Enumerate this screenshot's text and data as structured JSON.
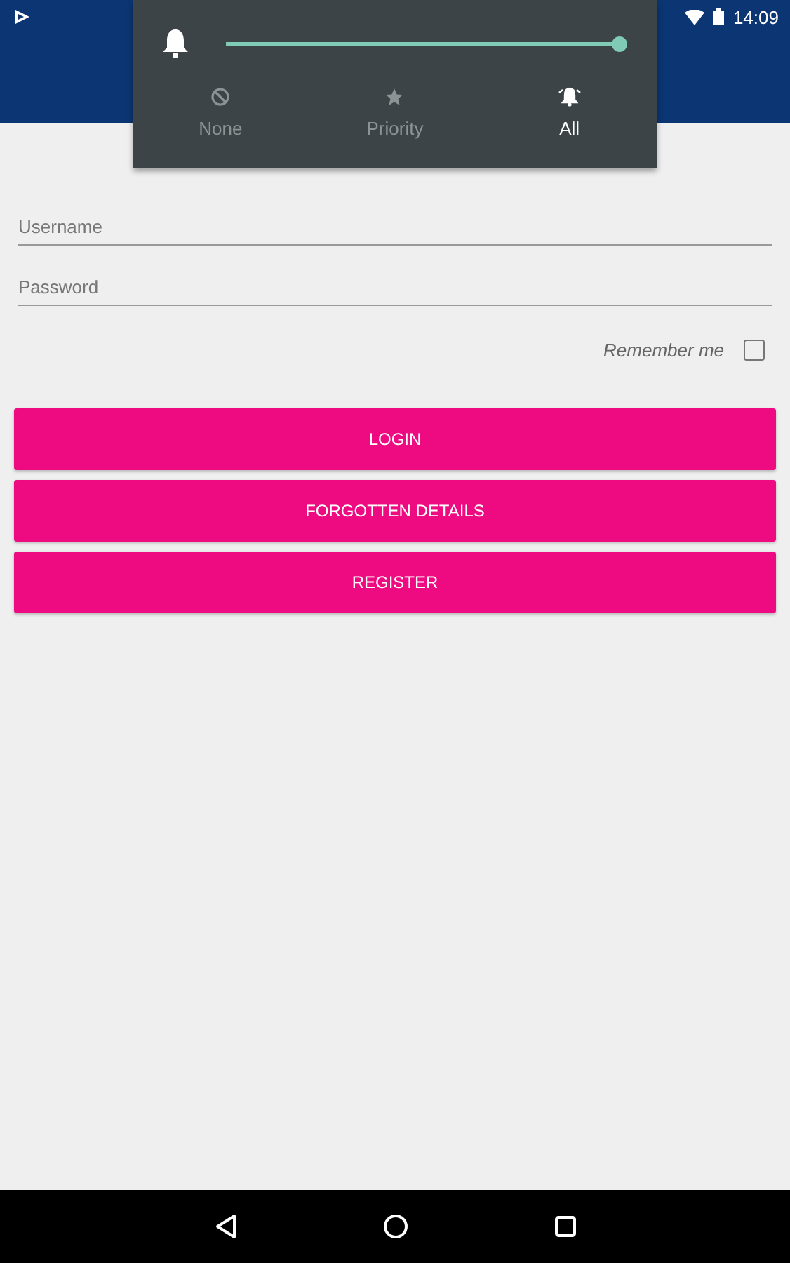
{
  "status_bar": {
    "time": "14:09"
  },
  "volume_panel": {
    "level": 1,
    "modes": [
      {
        "label": "None",
        "kind": "none",
        "selected": false
      },
      {
        "label": "Priority",
        "kind": "priority",
        "selected": false
      },
      {
        "label": "All",
        "kind": "all",
        "selected": true
      }
    ]
  },
  "form": {
    "username": {
      "placeholder": "Username"
    },
    "password": {
      "placeholder": "Password"
    },
    "remember": {
      "label": "Remember me",
      "checked": false
    }
  },
  "buttons": [
    "LOGIN",
    "FORGOTTEN DETAILS",
    "REGISTER"
  ]
}
